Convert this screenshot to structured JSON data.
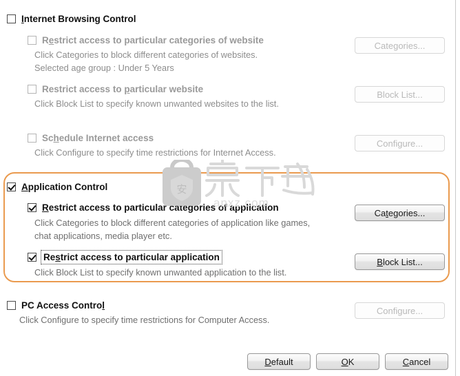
{
  "sections": [
    {
      "id": "internet-browsing-control",
      "title": "Internet Browsing Control",
      "accel": "I",
      "checked": false,
      "enabled": true,
      "options": [
        {
          "id": "restrict-categories-website",
          "label": "Restrict access to particular categories of website",
          "accel": "e",
          "checked": false,
          "enabled": false,
          "desc": [
            "Click Categories to block different categories of websites.",
            "Selected age group : Under 5 Years"
          ],
          "button": {
            "label": "Categories...",
            "accel": "e",
            "enabled": false
          }
        },
        {
          "id": "restrict-particular-website",
          "label": "Restrict access to particular website",
          "accel": "p",
          "checked": false,
          "enabled": false,
          "desc": [
            "Click Block List to specify known unwanted websites to the list."
          ],
          "button": {
            "label": "Block List...",
            "accel": "k",
            "enabled": false
          }
        },
        {
          "id": "schedule-internet-access",
          "label": "Schedule Internet access",
          "accel": "h",
          "checked": false,
          "enabled": false,
          "desc": [
            "Click Configure to specify time restrictions for Internet Access."
          ],
          "button": {
            "label": "Configure...",
            "accel": "f",
            "enabled": false
          }
        }
      ]
    },
    {
      "id": "application-control",
      "title": "Application Control",
      "accel": "A",
      "checked": true,
      "enabled": true,
      "highlighted": true,
      "options": [
        {
          "id": "restrict-categories-application",
          "label": "Restrict access to particular categories of application",
          "accel": "R",
          "checked": true,
          "enabled": true,
          "desc": [
            "Click Categories to block different categories of application like games,",
            "chat applications, media player etc."
          ],
          "button": {
            "label": "Categories...",
            "accel": "t",
            "enabled": true
          }
        },
        {
          "id": "restrict-particular-application",
          "label": "Restrict access to particular application",
          "accel": "s",
          "checked": true,
          "enabled": true,
          "focused": true,
          "desc": [
            "Click Block List to specify known unwanted application to the list."
          ],
          "button": {
            "label": "Block List...",
            "accel": "B",
            "enabled": true
          }
        }
      ]
    },
    {
      "id": "pc-access-control",
      "title": "PC Access Control",
      "accel": "l",
      "checked": false,
      "enabled": true,
      "options": [
        {
          "id": "pc-access-desc",
          "label": "",
          "checked": false,
          "enabled": true,
          "desc": [
            "Click Configure to specify time restrictions for Computer Access."
          ],
          "button": {
            "label": "Configure...",
            "accel": "f",
            "enabled": false
          }
        }
      ]
    }
  ],
  "labels": {
    "internet_title": "Internet Browsing Control",
    "opt_cat_website": "Restrict access to particular categories of website",
    "desc_cat_website_1": "Click Categories to block different categories of websites.",
    "desc_cat_website_2": "Selected age group : Under 5 Years",
    "opt_part_website": "Restrict access to particular website",
    "desc_part_website_1": "Click Block List to specify known unwanted websites to the list.",
    "opt_schedule": "Schedule Internet access",
    "desc_schedule_1": "Click Configure to specify time restrictions for Internet Access.",
    "app_title": "Application Control",
    "opt_cat_app": "Restrict access to particular categories of application",
    "desc_cat_app_1": "Click Categories to block different categories of application like games,",
    "desc_cat_app_2": "chat applications, media player etc.",
    "opt_part_app": "Restrict access to particular application",
    "desc_part_app_1": "Click Block List to specify known unwanted application to the list.",
    "pc_title": "PC Access Control",
    "desc_pc_1": "Click Configure to specify time restrictions for Computer Access."
  },
  "buttons": {
    "categories_web": "Categories...",
    "block_list_web": "Block List...",
    "configure_web": "Configure...",
    "categories_app": "Categories...",
    "block_list_app": "Block List...",
    "configure_pc": "Configure...",
    "default": "Default",
    "ok": "OK",
    "cancel": "Cancel"
  },
  "watermark": {
    "text_cn": "安下载",
    "text_en": "anxz.com",
    "shield_glyph": "安",
    "color": "#cfcfcf"
  },
  "theme": {
    "highlight_border": "#ea9a4e",
    "enabled_text": "#111111",
    "disabled_text": "#9a9a9a",
    "description_text": "#8d8d8d",
    "background": "#ffffff"
  }
}
